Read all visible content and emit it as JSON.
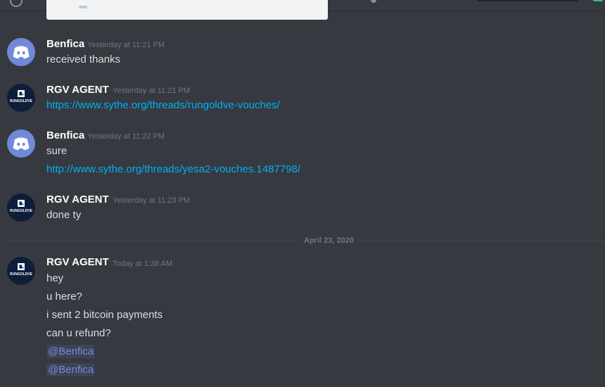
{
  "messages": [
    {
      "username": "Benfica",
      "timestamp": "Yesterday at 11:21 PM",
      "lines": [
        "received thanks"
      ]
    },
    {
      "username": "RGV AGENT",
      "timestamp": "Yesterday at 11:21 PM",
      "lines": [
        "https://www.sythe.org/threads/rungoldve-vouches/"
      ]
    },
    {
      "username": "Benfica",
      "timestamp": "Yesterday at 11:22 PM",
      "lines": [
        "sure",
        "http://www.sythe.org/threads/yesa2-vouches.1487798/"
      ]
    },
    {
      "username": "RGV AGENT",
      "timestamp": "Yesterday at 11:23 PM",
      "lines": [
        "done ty"
      ]
    },
    {
      "username": "RGV AGENT",
      "timestamp": "Today at 1:38 AM",
      "lines": [
        "hey",
        "u here?",
        "i sent 2 bitcoin payments",
        "can u refund?",
        "@Benfica",
        "@Benfica"
      ]
    }
  ],
  "date_divider": "April 23, 2020",
  "avatar_text": {
    "rgv": "RUNGOLDVE"
  },
  "colors": {
    "background": "#36393f",
    "link": "#00b0f4",
    "mention": "#7289da",
    "discord_avatar": "#7289da"
  }
}
